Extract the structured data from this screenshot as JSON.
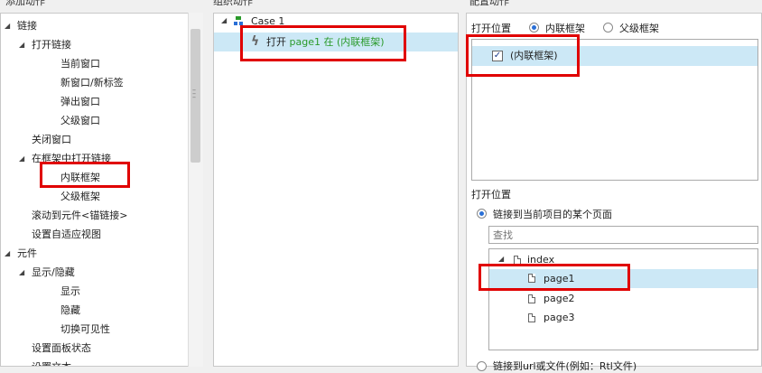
{
  "headers": {
    "left": "添加动作",
    "middle": "组织动作",
    "right": "配置动作"
  },
  "left_tree": [
    {
      "label": "链接",
      "expanded": true,
      "indent": 0
    },
    {
      "label": "打开链接",
      "expanded": true,
      "indent": 1
    },
    {
      "label": "当前窗口",
      "indent": 2
    },
    {
      "label": "新窗口/新标签",
      "indent": 2
    },
    {
      "label": "弹出窗口",
      "indent": 2
    },
    {
      "label": "父级窗口",
      "indent": 2
    },
    {
      "label": "关闭窗口",
      "indent": 1
    },
    {
      "label": "在框架中打开链接",
      "expanded": true,
      "indent": 1
    },
    {
      "label": "内联框架",
      "indent": 2
    },
    {
      "label": "父级框架",
      "indent": 2
    },
    {
      "label": "滚动到元件<锚链接>",
      "indent": 1
    },
    {
      "label": "设置自适应视图",
      "indent": 1
    },
    {
      "label": "元件",
      "expanded": true,
      "indent": 0
    },
    {
      "label": "显示/隐藏",
      "expanded": true,
      "indent": 1
    },
    {
      "label": "显示",
      "indent": 2
    },
    {
      "label": "隐藏",
      "indent": 2
    },
    {
      "label": "切换可见性",
      "indent": 2
    },
    {
      "label": "设置面板状态",
      "indent": 1
    },
    {
      "label": "设置文本",
      "indent": 1
    }
  ],
  "middle": {
    "case_label": "Case 1",
    "action": {
      "verb": "打开",
      "target": "page1",
      "mid": "在",
      "frame": "(内联框架)"
    }
  },
  "right": {
    "open_location_label": "打开位置",
    "radio_inline": "内联框架",
    "radio_parent": "父级框架",
    "frame_item": "(内联框架)",
    "section_label": "打开位置",
    "link_page_radio": "链接到当前项目的某个页面",
    "search_placeholder": "查找",
    "pages": [
      {
        "label": "index",
        "indent": 0,
        "expanded": true
      },
      {
        "label": "page1",
        "indent": 1,
        "selected": true
      },
      {
        "label": "page2",
        "indent": 1
      },
      {
        "label": "page3",
        "indent": 1
      }
    ],
    "bottom_radio": "链接到url或文件(例如：Rtl文件)"
  },
  "colors": {
    "selection": "#cce8f6",
    "highlight": "#e00000",
    "green": "#2a9a2a",
    "accent": "#2a6fd6"
  }
}
